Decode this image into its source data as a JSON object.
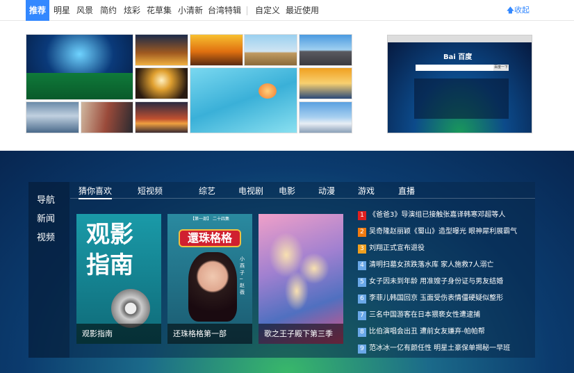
{
  "topnav": {
    "tabs": [
      "推荐",
      "明星",
      "风景",
      "简约",
      "炫彩",
      "花草集",
      "小清新",
      "台湾特辑"
    ],
    "extra_tabs": [
      "自定义",
      "最近使用"
    ],
    "collapse_label": "收起",
    "accent": "#3388ff"
  },
  "preview": {
    "logo_text": "Bai 百度",
    "search_button": "百度一下"
  },
  "sidebar": {
    "items": [
      "导航",
      "新闻",
      "视频"
    ]
  },
  "categories": [
    "猜你喜欢",
    "短视频",
    "综艺",
    "电视剧",
    "电影",
    "动漫",
    "游戏",
    "直播"
  ],
  "cards": [
    {
      "title": "观影指南",
      "poster_text": "观影指南"
    },
    {
      "title": "还珠格格第一部",
      "poster_text": "還珠格格",
      "poster_top": "【第一部】 二十四集",
      "poster_side": "小燕子─赵薇"
    },
    {
      "title": "歌之王子殿下第三季"
    }
  ],
  "news": [
    {
      "num": "1",
      "text": "《爸爸3》导演组已接触张嘉译韩寒邓超等人",
      "color": "#e02020"
    },
    {
      "num": "2",
      "text": "吴奇隆赵丽颖《蜀山》造型曝光 眼神犀利展霸气",
      "color": "#f07a10"
    },
    {
      "num": "3",
      "text": "刘翔正式宣布退役",
      "color": "#f0a020"
    },
    {
      "num": "4",
      "text": "清明扫墓女孩跌落水库 家人施救7人溺亡",
      "color": "#6aa8e8"
    },
    {
      "num": "5",
      "text": "女子因未到年龄 用准嫂子身份证与男友结婚",
      "color": "#6aa8e8"
    },
    {
      "num": "6",
      "text": "李菲儿韩国回京 玉面受伤表情僵硬疑似整形",
      "color": "#6aa8e8"
    },
    {
      "num": "7",
      "text": "三名中国游客在日本猥亵女性遭逮捕",
      "color": "#6aa8e8"
    },
    {
      "num": "8",
      "text": "比伯演唱会出丑 遭前女友嫌弃-帕帕帮",
      "color": "#6aa8e8"
    },
    {
      "num": "9",
      "text": "范冰冰一亿有颜任性 明星土豪保单揭秘一早班",
      "color": "#6aa8e8"
    }
  ]
}
